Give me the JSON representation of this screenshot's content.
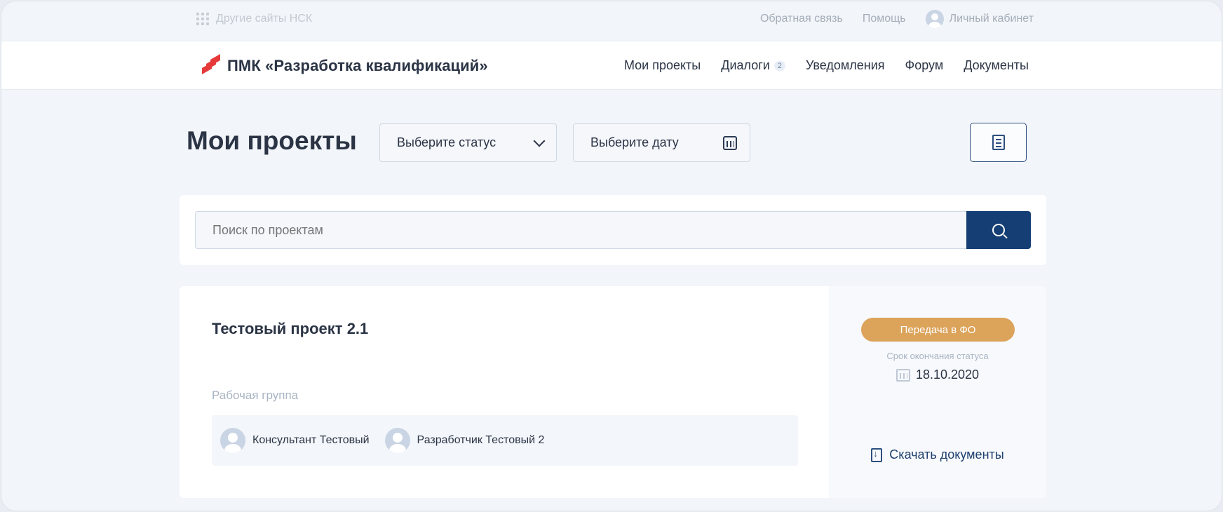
{
  "topbar": {
    "other_sites": "Другие сайты НСК",
    "feedback": "Обратная связь",
    "help": "Помощь",
    "account": "Личный кабинет"
  },
  "header": {
    "title": "ПМК «Разработка квалификаций»",
    "nav": [
      {
        "label": "Мои проекты"
      },
      {
        "label": "Диалоги",
        "badge": "2"
      },
      {
        "label": "Уведомления"
      },
      {
        "label": "Форум"
      },
      {
        "label": "Документы"
      }
    ]
  },
  "filters": {
    "page_title": "Мои проекты",
    "status_placeholder": "Выберите статус",
    "date_placeholder": "Выберите дату"
  },
  "search": {
    "placeholder": "Поиск по проектам"
  },
  "project": {
    "name": "Тестовый проект 2.1",
    "group_label": "Рабочая группа",
    "members": [
      {
        "name": "Консультант Тестовый"
      },
      {
        "name": "Разработчик Тестовый 2"
      }
    ],
    "status": "Передача в ФО",
    "status_color": "#dca35b",
    "deadline_label": "Срок окончания статуса",
    "deadline": "18.10.2020",
    "download_label": "Скачать документы"
  },
  "colors": {
    "accent": "#153f74",
    "background": "#f2f5f9"
  }
}
